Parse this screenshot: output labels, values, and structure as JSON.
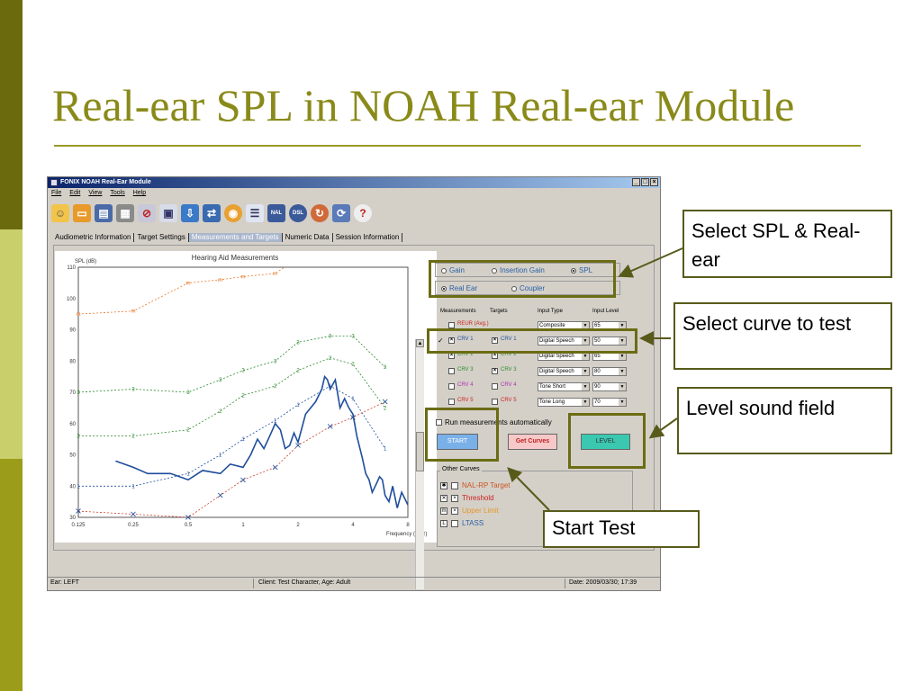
{
  "slide": {
    "title": "Real-ear SPL in NOAH Real-ear Module",
    "callouts": [
      "Select SPL & Real-ear",
      "Select curve to test",
      "Level sound field",
      "Start Test"
    ]
  },
  "window": {
    "title": "FONIX NOAH Real-Ear Module",
    "menu": [
      "File",
      "Edit",
      "View",
      "Tools",
      "Help"
    ],
    "controls": [
      "_",
      "□",
      "×"
    ],
    "toolbar_icons": [
      "open-client-icon",
      "open-folder-icon",
      "save-icon",
      "print-icon",
      "clear-icon",
      "view-icon",
      "import-icon",
      "export-icon",
      "rem-icon",
      "list-icon",
      "nal-icon",
      "dsl-icon",
      "setup-icon",
      "help-center-icon",
      "help-icon"
    ],
    "toolbar_text": {
      "nal": "NAL",
      "dsl": "DSL"
    }
  },
  "tabs": [
    "Audiometric Information",
    "Target Settings",
    "Measurements and Targets",
    "Numeric Data",
    "Session Information"
  ],
  "active_tab": "Measurements and Targets",
  "chart_data": {
    "type": "line",
    "title": "Hearing Aid Measurements",
    "ylabel": "SPL (dB)",
    "xlabel": "Frequency (KHz)",
    "x_scale": "log",
    "xlim": [
      0.125,
      8
    ],
    "ylim": [
      30,
      110
    ],
    "x_ticks": [
      "0.125",
      "0.25",
      "0.5",
      "1",
      "2",
      "4",
      "8"
    ],
    "y_ticks": [
      "110",
      "100",
      "90",
      "80",
      "70",
      "60",
      "50",
      "40",
      "30"
    ],
    "series": [
      {
        "name": "CRV 1",
        "color": "#1f4e9c",
        "style": "solid",
        "marker": "",
        "x": [
          0.2,
          0.25,
          0.3,
          0.35,
          0.4,
          0.5,
          0.6,
          0.75,
          0.85,
          1.0,
          1.1,
          1.2,
          1.3,
          1.4,
          1.5,
          1.6,
          1.7,
          1.8,
          1.9,
          2.0,
          2.2,
          2.5,
          2.7,
          2.8,
          2.9,
          3.0,
          3.2,
          3.4,
          3.6,
          3.8,
          4.0,
          4.2,
          4.5,
          4.7,
          4.9,
          5.1,
          5.3,
          5.6,
          5.8,
          6.0,
          6.3,
          6.6,
          7.0,
          7.4,
          8.0
        ],
        "y": [
          48,
          46,
          44,
          44,
          44,
          42,
          45,
          44,
          47,
          46,
          50,
          55,
          52,
          56,
          60,
          58,
          52,
          53,
          57,
          54,
          63,
          67,
          71,
          75,
          74,
          71,
          74,
          65,
          68,
          65,
          63,
          56,
          49,
          44,
          42,
          38,
          40,
          43,
          42,
          37,
          35,
          40,
          33,
          38,
          34
        ]
      },
      {
        "name": "CRV 1 target",
        "color": "#1f4e9c",
        "style": "dashed",
        "marker": "1",
        "x": [
          0.125,
          0.25,
          0.5,
          0.75,
          1.0,
          1.5,
          2.0,
          3.0,
          4.0,
          6.0
        ],
        "y": [
          40,
          40,
          44,
          50,
          55,
          61,
          66,
          72,
          68,
          52
        ]
      },
      {
        "name": "CRV 2 target",
        "color": "#2e8a2e",
        "style": "dashed",
        "marker": "2",
        "x": [
          0.125,
          0.25,
          0.5,
          0.75,
          1.0,
          1.5,
          2.0,
          3.0,
          4.0,
          6.0
        ],
        "y": [
          56,
          56,
          58,
          64,
          69,
          72,
          77,
          81,
          79,
          65
        ]
      },
      {
        "name": "CRV 3 target",
        "color": "#2e8a2e",
        "style": "dashed",
        "marker": "3",
        "x": [
          0.125,
          0.25,
          0.5,
          0.75,
          1.0,
          1.5,
          2.0,
          3.0,
          4.0,
          6.0
        ],
        "y": [
          70,
          71,
          70,
          74,
          77,
          80,
          86,
          88,
          88,
          78
        ]
      },
      {
        "name": "Upper Limit",
        "color": "#e8782a",
        "style": "dashed",
        "marker": "m",
        "x": [
          0.125,
          0.25,
          0.5,
          0.75,
          1.0,
          1.5,
          2.0,
          3.0,
          4.0,
          6.0
        ],
        "y": [
          95,
          96,
          105,
          106,
          107,
          108,
          113,
          113,
          113,
          112
        ]
      },
      {
        "name": "Threshold",
        "color": "#d0402a",
        "style": "dashed",
        "marker": "×",
        "x": [
          0.125,
          0.25,
          0.5,
          0.75,
          1.0,
          1.5,
          2.0,
          3.0,
          4.0,
          6.0
        ],
        "y": [
          32,
          31,
          30,
          37,
          42,
          46,
          53,
          59,
          62,
          67
        ]
      }
    ]
  },
  "mode": {
    "measure_options": [
      "Gain",
      "Insertion Gain",
      "SPL"
    ],
    "measure_selected": "SPL",
    "ear_options": [
      "Real Ear",
      "Coupler"
    ],
    "ear_selected": "Real Ear"
  },
  "measurements": {
    "headers": [
      "Measurements",
      "Targets",
      "Input Type",
      "Input Level"
    ],
    "rows": [
      {
        "meas": "REUR (Avg.)",
        "meas_color": "#cc2222",
        "meas_checked": false,
        "target": "",
        "target_color": "#000",
        "target_checked": false,
        "input_type": "Composite",
        "input_level": "65",
        "selected": false
      },
      {
        "meas": "CRV 1",
        "meas_color": "#1f4e9c",
        "meas_checked": true,
        "target": "CRV 1",
        "target_color": "#1f4e9c",
        "target_checked": true,
        "input_type": "Digital Speech",
        "input_level": "50",
        "selected": true
      },
      {
        "meas": "CRV 2",
        "meas_color": "#2e8a2e",
        "meas_checked": true,
        "target": "CRV 2",
        "target_color": "#2e8a2e",
        "target_checked": true,
        "input_type": "Digital Speech",
        "input_level": "65",
        "selected": false
      },
      {
        "meas": "CRV 3",
        "meas_color": "#2e8a2e",
        "meas_checked": false,
        "target": "CRV 3",
        "target_color": "#2e8a2e",
        "target_checked": true,
        "input_type": "Digital Speech",
        "input_level": "80",
        "selected": false
      },
      {
        "meas": "CRV 4",
        "meas_color": "#b030b0",
        "meas_checked": false,
        "target": "CRV 4",
        "target_color": "#b030b0",
        "target_checked": false,
        "input_type": "Tone Short",
        "input_level": "90",
        "selected": false
      },
      {
        "meas": "CRV 5",
        "meas_color": "#cc2222",
        "meas_checked": false,
        "target": "CRV 5",
        "target_color": "#cc2222",
        "target_checked": false,
        "input_type": "Tone Long",
        "input_level": "70",
        "selected": false
      }
    ]
  },
  "run_auto_label": "Run measurements automatically",
  "buttons": {
    "start": "START",
    "get_curves": "Get Curves",
    "level": "LEVEL"
  },
  "other_curves": {
    "title": "Other Curves",
    "items": [
      {
        "glyph": "✱",
        "label": "NAL-RP Target",
        "color": "#cc5520",
        "checked": false
      },
      {
        "glyph": "✕",
        "label": "Threshold",
        "color": "#cc2222",
        "checked": true
      },
      {
        "glyph": "m",
        "label": "Upper Limit",
        "color": "#e8962a",
        "checked": true
      },
      {
        "glyph": "L",
        "label": "LTASS",
        "color": "#2a5fa8",
        "checked": false
      }
    ]
  },
  "status": {
    "ear": "Ear: LEFT",
    "client": "Client: Test Character, Age: Adult",
    "date": "Date: 2009/03/30; 17:39"
  }
}
